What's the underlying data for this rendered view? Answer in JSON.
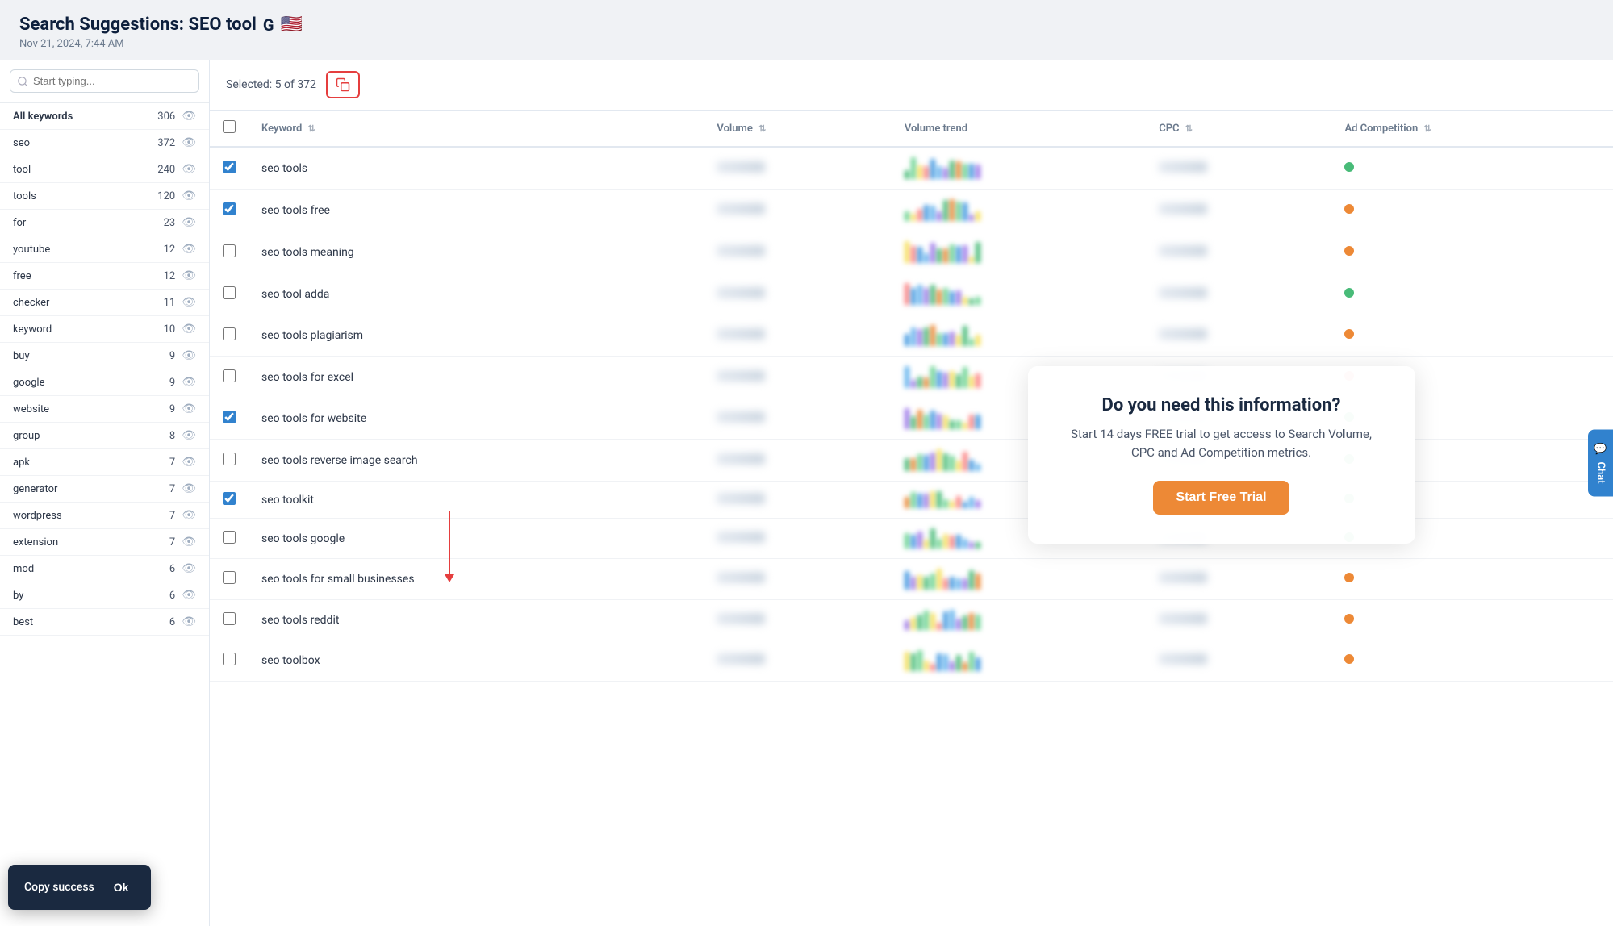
{
  "header": {
    "title": "Search Suggestions: SEO tool",
    "subtitle": "Nov 21, 2024, 7:44 AM",
    "google_icon": "G",
    "flag": "🇺🇸"
  },
  "sidebar": {
    "search_placeholder": "Start typing...",
    "keywords": [
      {
        "label": "All keywords",
        "count": 306,
        "is_all": true
      },
      {
        "label": "seo",
        "count": 372
      },
      {
        "label": "tool",
        "count": 240
      },
      {
        "label": "tools",
        "count": 120
      },
      {
        "label": "for",
        "count": 23
      },
      {
        "label": "youtube",
        "count": 12
      },
      {
        "label": "free",
        "count": 12
      },
      {
        "label": "checker",
        "count": 11
      },
      {
        "label": "keyword",
        "count": 10
      },
      {
        "label": "buy",
        "count": 9
      },
      {
        "label": "google",
        "count": 9
      },
      {
        "label": "website",
        "count": 9
      },
      {
        "label": "group",
        "count": 8
      },
      {
        "label": "apk",
        "count": 7
      },
      {
        "label": "generator",
        "count": 7
      },
      {
        "label": "wordpress",
        "count": 7
      },
      {
        "label": "extension",
        "count": 7
      },
      {
        "label": "mod",
        "count": 6
      },
      {
        "label": "by",
        "count": 6
      },
      {
        "label": "best",
        "count": 6
      }
    ]
  },
  "table_header": {
    "selected_label": "Selected: 5 of 372",
    "copy_title": "Copy selected"
  },
  "columns": {
    "keyword": "Keyword",
    "volume": "Volume",
    "volume_trend": "Volume trend",
    "cpc": "CPC",
    "ad_competition": "Ad Competition"
  },
  "rows": [
    {
      "id": 1,
      "keyword": "seo tools",
      "checked": true,
      "ad_color": "green"
    },
    {
      "id": 2,
      "keyword": "seo tools free",
      "checked": true,
      "ad_color": "orange"
    },
    {
      "id": 3,
      "keyword": "seo tools meaning",
      "checked": false,
      "ad_color": "orange"
    },
    {
      "id": 4,
      "keyword": "seo tool adda",
      "checked": false,
      "ad_color": "green"
    },
    {
      "id": 5,
      "keyword": "seo tools plagiarism",
      "checked": false,
      "ad_color": "orange"
    },
    {
      "id": 6,
      "keyword": "seo tools for excel",
      "checked": false,
      "ad_color": "red"
    },
    {
      "id": 7,
      "keyword": "seo tools for website",
      "checked": true,
      "ad_color": "green"
    },
    {
      "id": 8,
      "keyword": "seo tools reverse image search",
      "checked": false,
      "ad_color": "green"
    },
    {
      "id": 9,
      "keyword": "seo toolkit",
      "checked": true,
      "ad_color": "green"
    },
    {
      "id": 10,
      "keyword": "seo tools google",
      "checked": false,
      "ad_color": "green"
    },
    {
      "id": 11,
      "keyword": "seo tools for small businesses",
      "checked": false,
      "ad_color": "orange"
    },
    {
      "id": 12,
      "keyword": "seo tools reddit",
      "checked": false,
      "ad_color": "orange"
    },
    {
      "id": 13,
      "keyword": "seo toolbox",
      "checked": false,
      "ad_color": "orange"
    }
  ],
  "overlay": {
    "title": "Do you need this information?",
    "body": "Start 14 days FREE trial to get access to Search Volume, CPC and Ad Competition metrics.",
    "cta_label": "Start Free Trial"
  },
  "toast": {
    "message": "Copy success",
    "ok_label": "Ok"
  },
  "chat_button": {
    "label": "Chat"
  },
  "colors": {
    "accent_blue": "#3182ce",
    "accent_orange": "#ed8936",
    "accent_red": "#e53e3e",
    "accent_green": "#48bb78"
  }
}
